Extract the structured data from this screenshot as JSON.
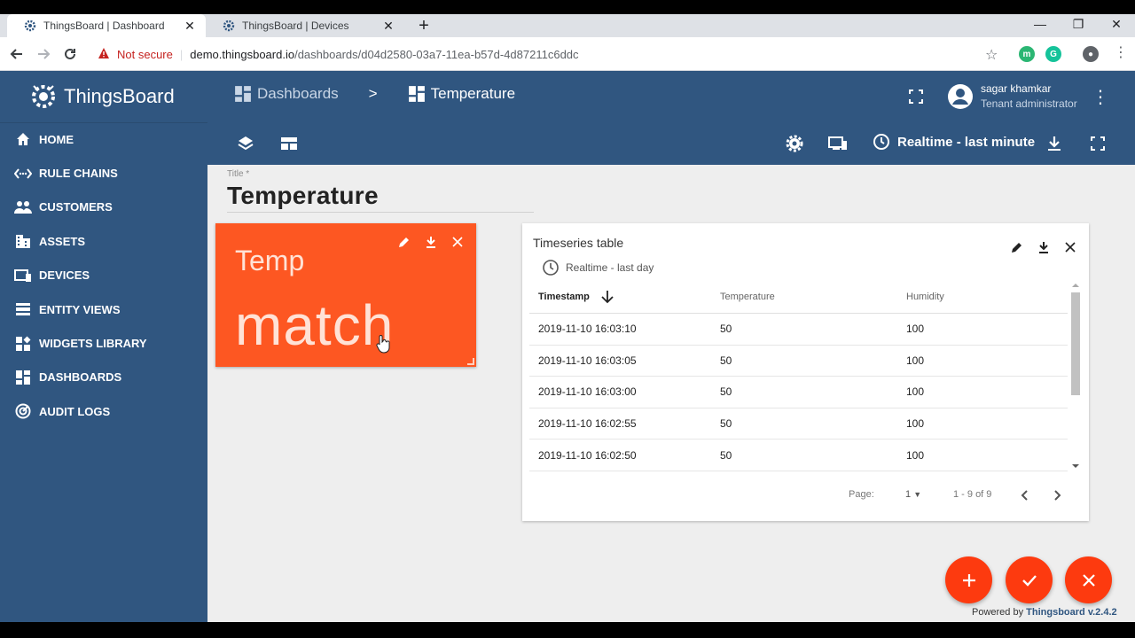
{
  "browser": {
    "tabs": [
      {
        "title": "ThingsBoard | Dashboard",
        "active": true
      },
      {
        "title": "ThingsBoard | Devices",
        "active": false
      }
    ],
    "security_label": "Not secure",
    "url_host": "demo.thingsboard.io",
    "url_path": "/dashboards/d04d2580-03a7-11ea-b57d-4d87211c6ddc"
  },
  "app": {
    "brand": "ThingsBoard",
    "colors": {
      "primary": "#305680",
      "accent": "#fd5722",
      "fab": "#fd3a0f"
    }
  },
  "sidebar": {
    "items": [
      {
        "label": "HOME",
        "icon": "home-icon"
      },
      {
        "label": "RULE CHAINS",
        "icon": "code-arrows-icon"
      },
      {
        "label": "CUSTOMERS",
        "icon": "people-icon"
      },
      {
        "label": "ASSETS",
        "icon": "domain-icon"
      },
      {
        "label": "DEVICES",
        "icon": "devices-icon"
      },
      {
        "label": "ENTITY VIEWS",
        "icon": "view-quilt-icon"
      },
      {
        "label": "WIDGETS LIBRARY",
        "icon": "widgets-icon"
      },
      {
        "label": "DASHBOARDS",
        "icon": "dashboard-icon"
      },
      {
        "label": "AUDIT LOGS",
        "icon": "track-changes-icon"
      }
    ]
  },
  "header": {
    "breadcrumb": [
      {
        "label": "Dashboards"
      },
      {
        "label": "Temperature"
      }
    ],
    "breadcrumb_sep": ">",
    "user_name": "sagar khamkar",
    "user_role": "Tenant administrator",
    "time_window": "Realtime - last minute"
  },
  "main": {
    "title_label": "Title *",
    "title_value": "Temperature"
  },
  "widget_card": {
    "title": "Temp",
    "value": "match"
  },
  "timeseries": {
    "title": "Timeseries table",
    "time_window": "Realtime - last day",
    "columns": [
      "Timestamp",
      "Temperature",
      "Humidity"
    ],
    "rows": [
      [
        "2019-11-10 16:03:10",
        "50",
        "100"
      ],
      [
        "2019-11-10 16:03:05",
        "50",
        "100"
      ],
      [
        "2019-11-10 16:03:00",
        "50",
        "100"
      ],
      [
        "2019-11-10 16:02:55",
        "50",
        "100"
      ],
      [
        "2019-11-10 16:02:50",
        "50",
        "100"
      ]
    ],
    "page_label": "Page:",
    "page_value": "1",
    "range_label": "1 - 9 of 9"
  },
  "footer": {
    "powered_prefix": "Powered by",
    "powered_brand": "Thingsboard v.2.4.2"
  }
}
